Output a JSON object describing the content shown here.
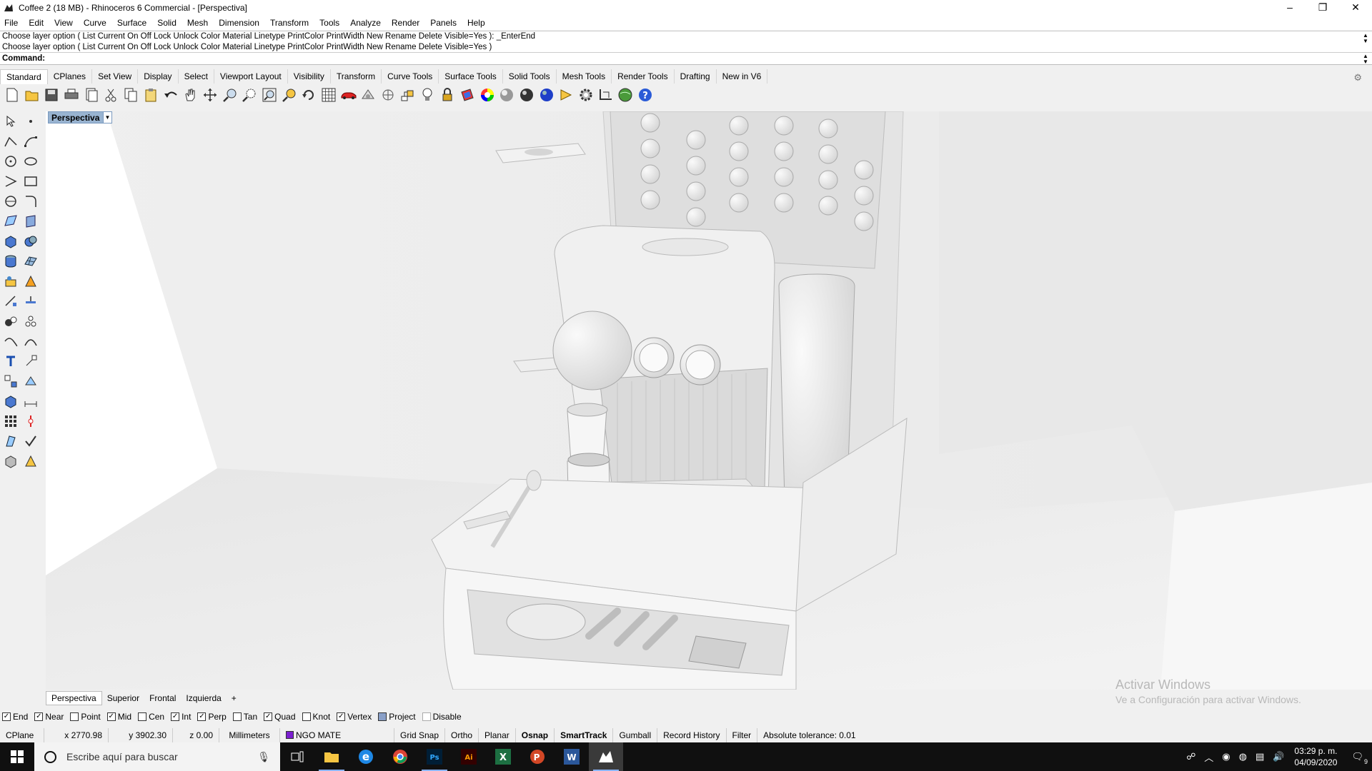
{
  "window": {
    "title": "Coffee 2 (18 MB) - Rhinoceros 6 Commercial - [Perspectiva]",
    "controls": [
      "–",
      "❐",
      "✕"
    ]
  },
  "menu": [
    "File",
    "Edit",
    "View",
    "Curve",
    "Surface",
    "Solid",
    "Mesh",
    "Dimension",
    "Transform",
    "Tools",
    "Analyze",
    "Render",
    "Panels",
    "Help"
  ],
  "command": {
    "history_line1": "Choose layer option ( List  Current  On  Off  Lock  Unlock  Color  Material  Linetype  PrintColor  PrintWidth  New  Rename  Delete  Visible=Yes ): _EnterEnd",
    "history_line2": "Choose layer option ( List  Current  On  Off  Lock  Unlock  Color  Material  Linetype  PrintColor  PrintWidth  New  Rename  Delete  Visible=Yes )",
    "prompt_label": "Command:",
    "input_value": ""
  },
  "toolbar_tabs": [
    "Standard",
    "CPlanes",
    "Set View",
    "Display",
    "Select",
    "Viewport Layout",
    "Visibility",
    "Transform",
    "Curve Tools",
    "Surface Tools",
    "Solid Tools",
    "Mesh Tools",
    "Render Tools",
    "Drafting",
    "New in V6"
  ],
  "standard_tools": [
    "new-file",
    "open",
    "save",
    "print",
    "import",
    "cut",
    "copy",
    "paste",
    "undo",
    "pan",
    "move",
    "zoom",
    "zoom-window",
    "zoom-extents",
    "zoom-selected",
    "rotate-view",
    "four-viewports",
    "car-render",
    "display-mode",
    "cplane",
    "light",
    "lock",
    "layer",
    "color-wheel",
    "shaded-sphere",
    "rendered-sphere",
    "blue-sphere",
    "sun",
    "options-gear",
    "grid",
    "sphere-globe",
    "help"
  ],
  "viewport": {
    "label": "Perspectiva",
    "tabs": [
      "Perspectiva",
      "Superior",
      "Frontal",
      "Izquierda"
    ],
    "add_tab": "+"
  },
  "watermark": {
    "line1": "Activar Windows",
    "line2": "Ve a Configuración para activar Windows."
  },
  "osnaps": [
    {
      "label": "End",
      "checked": true
    },
    {
      "label": "Near",
      "checked": true
    },
    {
      "label": "Point",
      "checked": false
    },
    {
      "label": "Mid",
      "checked": true
    },
    {
      "label": "Cen",
      "checked": false
    },
    {
      "label": "Int",
      "checked": true
    },
    {
      "label": "Perp",
      "checked": true
    },
    {
      "label": "Tan",
      "checked": false
    },
    {
      "label": "Quad",
      "checked": true
    },
    {
      "label": "Knot",
      "checked": false
    },
    {
      "label": "Vertex",
      "checked": true
    },
    {
      "label": "Project",
      "checked": false
    },
    {
      "label": "Disable",
      "checked": false
    }
  ],
  "status": {
    "cplane": "CPlane",
    "x": "x 2770.98",
    "y": "y 3902.30",
    "z": "z 0.00",
    "units": "Millimeters",
    "layer": "NGO MATE",
    "layer_color": "#7b1fd0",
    "grid_snap": "Grid Snap",
    "ortho": "Ortho",
    "planar": "Planar",
    "osnap": "Osnap",
    "smarttrack": "SmartTrack",
    "gumball": "Gumball",
    "record_history": "Record History",
    "filter": "Filter",
    "tolerance": "Absolute tolerance: 0.01"
  },
  "taskbar": {
    "search_placeholder": "Escribe aquí para buscar",
    "time": "03:29 p. m.",
    "date": "04/09/2020",
    "notification_count": "9"
  }
}
